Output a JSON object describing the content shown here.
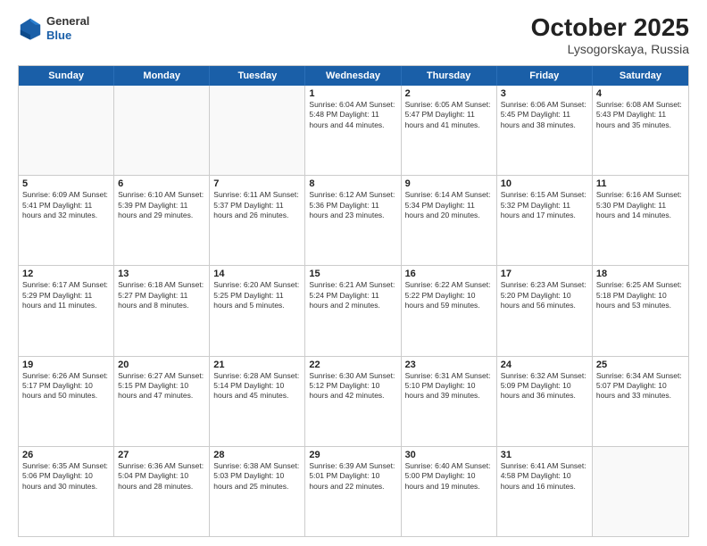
{
  "header": {
    "logo_general": "General",
    "logo_blue": "Blue",
    "month_title": "October 2025",
    "location": "Lysogorskaya, Russia"
  },
  "days_of_week": [
    "Sunday",
    "Monday",
    "Tuesday",
    "Wednesday",
    "Thursday",
    "Friday",
    "Saturday"
  ],
  "rows": [
    [
      {
        "day": "",
        "info": ""
      },
      {
        "day": "",
        "info": ""
      },
      {
        "day": "",
        "info": ""
      },
      {
        "day": "1",
        "info": "Sunrise: 6:04 AM\nSunset: 5:48 PM\nDaylight: 11 hours\nand 44 minutes."
      },
      {
        "day": "2",
        "info": "Sunrise: 6:05 AM\nSunset: 5:47 PM\nDaylight: 11 hours\nand 41 minutes."
      },
      {
        "day": "3",
        "info": "Sunrise: 6:06 AM\nSunset: 5:45 PM\nDaylight: 11 hours\nand 38 minutes."
      },
      {
        "day": "4",
        "info": "Sunrise: 6:08 AM\nSunset: 5:43 PM\nDaylight: 11 hours\nand 35 minutes."
      }
    ],
    [
      {
        "day": "5",
        "info": "Sunrise: 6:09 AM\nSunset: 5:41 PM\nDaylight: 11 hours\nand 32 minutes."
      },
      {
        "day": "6",
        "info": "Sunrise: 6:10 AM\nSunset: 5:39 PM\nDaylight: 11 hours\nand 29 minutes."
      },
      {
        "day": "7",
        "info": "Sunrise: 6:11 AM\nSunset: 5:37 PM\nDaylight: 11 hours\nand 26 minutes."
      },
      {
        "day": "8",
        "info": "Sunrise: 6:12 AM\nSunset: 5:36 PM\nDaylight: 11 hours\nand 23 minutes."
      },
      {
        "day": "9",
        "info": "Sunrise: 6:14 AM\nSunset: 5:34 PM\nDaylight: 11 hours\nand 20 minutes."
      },
      {
        "day": "10",
        "info": "Sunrise: 6:15 AM\nSunset: 5:32 PM\nDaylight: 11 hours\nand 17 minutes."
      },
      {
        "day": "11",
        "info": "Sunrise: 6:16 AM\nSunset: 5:30 PM\nDaylight: 11 hours\nand 14 minutes."
      }
    ],
    [
      {
        "day": "12",
        "info": "Sunrise: 6:17 AM\nSunset: 5:29 PM\nDaylight: 11 hours\nand 11 minutes."
      },
      {
        "day": "13",
        "info": "Sunrise: 6:18 AM\nSunset: 5:27 PM\nDaylight: 11 hours\nand 8 minutes."
      },
      {
        "day": "14",
        "info": "Sunrise: 6:20 AM\nSunset: 5:25 PM\nDaylight: 11 hours\nand 5 minutes."
      },
      {
        "day": "15",
        "info": "Sunrise: 6:21 AM\nSunset: 5:24 PM\nDaylight: 11 hours\nand 2 minutes."
      },
      {
        "day": "16",
        "info": "Sunrise: 6:22 AM\nSunset: 5:22 PM\nDaylight: 10 hours\nand 59 minutes."
      },
      {
        "day": "17",
        "info": "Sunrise: 6:23 AM\nSunset: 5:20 PM\nDaylight: 10 hours\nand 56 minutes."
      },
      {
        "day": "18",
        "info": "Sunrise: 6:25 AM\nSunset: 5:18 PM\nDaylight: 10 hours\nand 53 minutes."
      }
    ],
    [
      {
        "day": "19",
        "info": "Sunrise: 6:26 AM\nSunset: 5:17 PM\nDaylight: 10 hours\nand 50 minutes."
      },
      {
        "day": "20",
        "info": "Sunrise: 6:27 AM\nSunset: 5:15 PM\nDaylight: 10 hours\nand 47 minutes."
      },
      {
        "day": "21",
        "info": "Sunrise: 6:28 AM\nSunset: 5:14 PM\nDaylight: 10 hours\nand 45 minutes."
      },
      {
        "day": "22",
        "info": "Sunrise: 6:30 AM\nSunset: 5:12 PM\nDaylight: 10 hours\nand 42 minutes."
      },
      {
        "day": "23",
        "info": "Sunrise: 6:31 AM\nSunset: 5:10 PM\nDaylight: 10 hours\nand 39 minutes."
      },
      {
        "day": "24",
        "info": "Sunrise: 6:32 AM\nSunset: 5:09 PM\nDaylight: 10 hours\nand 36 minutes."
      },
      {
        "day": "25",
        "info": "Sunrise: 6:34 AM\nSunset: 5:07 PM\nDaylight: 10 hours\nand 33 minutes."
      }
    ],
    [
      {
        "day": "26",
        "info": "Sunrise: 6:35 AM\nSunset: 5:06 PM\nDaylight: 10 hours\nand 30 minutes."
      },
      {
        "day": "27",
        "info": "Sunrise: 6:36 AM\nSunset: 5:04 PM\nDaylight: 10 hours\nand 28 minutes."
      },
      {
        "day": "28",
        "info": "Sunrise: 6:38 AM\nSunset: 5:03 PM\nDaylight: 10 hours\nand 25 minutes."
      },
      {
        "day": "29",
        "info": "Sunrise: 6:39 AM\nSunset: 5:01 PM\nDaylight: 10 hours\nand 22 minutes."
      },
      {
        "day": "30",
        "info": "Sunrise: 6:40 AM\nSunset: 5:00 PM\nDaylight: 10 hours\nand 19 minutes."
      },
      {
        "day": "31",
        "info": "Sunrise: 6:41 AM\nSunset: 4:58 PM\nDaylight: 10 hours\nand 16 minutes."
      },
      {
        "day": "",
        "info": ""
      }
    ]
  ]
}
